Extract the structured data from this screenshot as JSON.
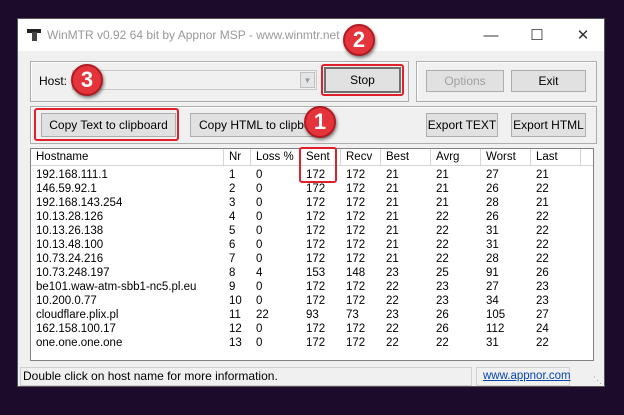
{
  "window": {
    "title": "WinMTR v0.92 64 bit by Appnor MSP - www.winmtr.net"
  },
  "toolbar": {
    "host_label": "Host:",
    "host_value": "",
    "stop": "Stop",
    "options": "Options",
    "exit": "Exit",
    "copy_text": "Copy Text to clipboard",
    "copy_html": "Copy HTML to clipboard",
    "export_text": "Export TEXT",
    "export_html": "Export HTML"
  },
  "badges": [
    "1",
    "2",
    "3"
  ],
  "annotation_color": "#e0202a",
  "table": {
    "columns": [
      "Hostname",
      "Nr",
      "Loss %",
      "Sent",
      "Recv",
      "Best",
      "Avrg",
      "Worst",
      "Last"
    ],
    "rows": [
      [
        "192.168.111.1",
        "1",
        "0",
        "172",
        "172",
        "21",
        "21",
        "27",
        "21"
      ],
      [
        "146.59.92.1",
        "2",
        "0",
        "172",
        "172",
        "21",
        "21",
        "26",
        "22"
      ],
      [
        "192.168.143.254",
        "3",
        "0",
        "172",
        "172",
        "21",
        "21",
        "28",
        "21"
      ],
      [
        "10.13.28.126",
        "4",
        "0",
        "172",
        "172",
        "21",
        "22",
        "26",
        "22"
      ],
      [
        "10.13.26.138",
        "5",
        "0",
        "172",
        "172",
        "21",
        "22",
        "31",
        "22"
      ],
      [
        "10.13.48.100",
        "6",
        "0",
        "172",
        "172",
        "21",
        "22",
        "31",
        "22"
      ],
      [
        "10.73.24.216",
        "7",
        "0",
        "172",
        "172",
        "21",
        "22",
        "28",
        "22"
      ],
      [
        "10.73.248.197",
        "8",
        "4",
        "153",
        "148",
        "23",
        "25",
        "91",
        "26"
      ],
      [
        "be101.waw-atm-sbb1-nc5.pl.eu",
        "9",
        "0",
        "172",
        "172",
        "22",
        "23",
        "27",
        "23"
      ],
      [
        "10.200.0.77",
        "10",
        "0",
        "172",
        "172",
        "22",
        "23",
        "34",
        "23"
      ],
      [
        "cloudflare.plix.pl",
        "11",
        "22",
        "93",
        "73",
        "23",
        "26",
        "105",
        "27"
      ],
      [
        "162.158.100.17",
        "12",
        "0",
        "172",
        "172",
        "22",
        "26",
        "112",
        "24"
      ],
      [
        "one.one.one.one",
        "13",
        "0",
        "172",
        "172",
        "22",
        "22",
        "31",
        "22"
      ]
    ]
  },
  "status": {
    "message": "Double click on host name for more information.",
    "link": "www.appnor.com"
  }
}
